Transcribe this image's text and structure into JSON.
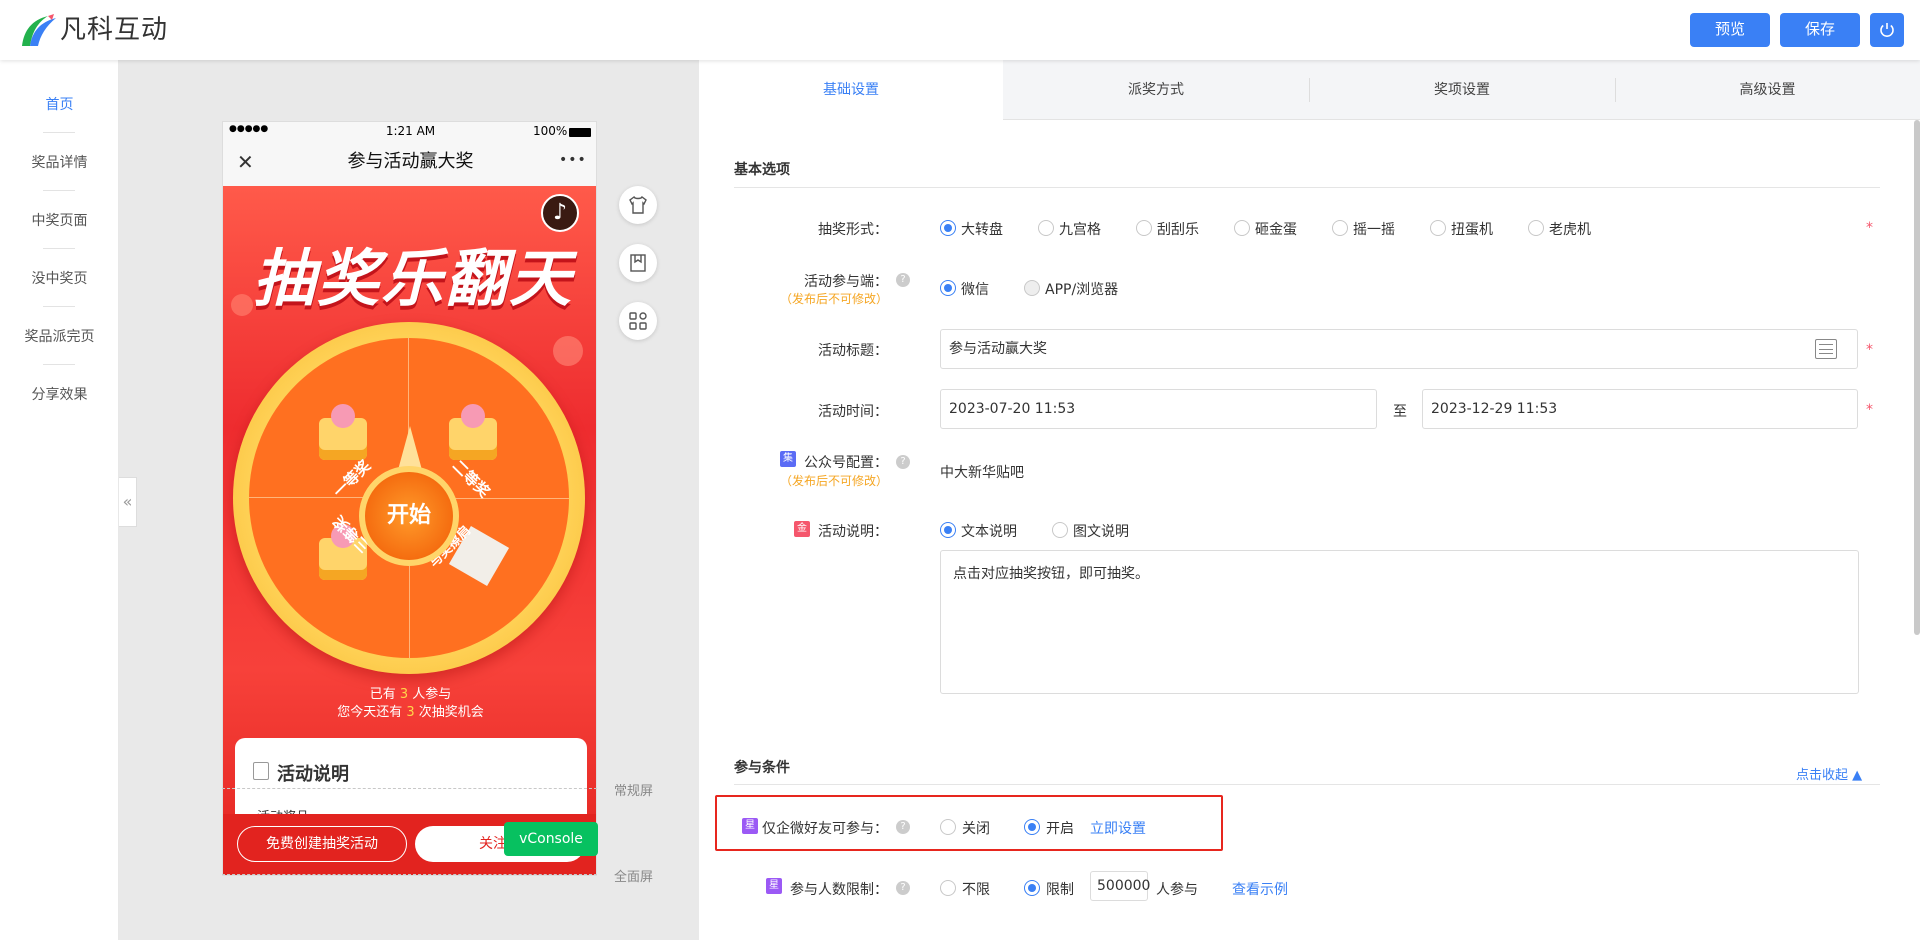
{
  "brand": {
    "name": "凡科互动",
    "colors": {
      "accent": "#3a80f5",
      "danger": "#e7261e",
      "vconsole": "#07c160"
    }
  },
  "header": {
    "preview_label": "预览",
    "save_label": "保存",
    "power_icon": "power-icon"
  },
  "sidebar": {
    "items": [
      {
        "label": "首页",
        "active": true
      },
      {
        "label": "奖品详情"
      },
      {
        "label": "中奖页面"
      },
      {
        "label": "没中奖页"
      },
      {
        "label": "奖品派完页"
      },
      {
        "label": "分享效果"
      }
    ]
  },
  "collapse_handle": "«",
  "phone": {
    "status": {
      "signal": "●●●●●",
      "time": "1:21 AM",
      "battery": "100%"
    },
    "nav": {
      "close": "✕",
      "title": "参与活动赢大奖",
      "more": "•••"
    },
    "banner_title": "抽奖乐翻天",
    "music_icon": "♪",
    "wheel": {
      "start_label": "开始",
      "prizes": [
        "一等奖",
        "二等奖",
        "三等奖",
        "与奖擦肩"
      ]
    },
    "join_line1_prefix": "已有",
    "join_count": "3",
    "join_line1_suffix": "人参与",
    "join_line2_prefix": "您今天还有",
    "chance_count": "3",
    "join_line2_suffix": "次抽奖机会",
    "rules": {
      "title": "活动说明",
      "prize_heading": "活动奖品"
    },
    "bottom": {
      "create_label": "免费创建抽奖活动",
      "follow_label": "关注我"
    }
  },
  "vconsole_label": "vConsole",
  "screen_markers": {
    "normal": "常规屏",
    "full": "全面屏"
  },
  "side_tools": [
    "shirt-icon",
    "page-icon",
    "grid-icon"
  ],
  "tabs": [
    {
      "label": "基础设置",
      "active": true
    },
    {
      "label": "派奖方式"
    },
    {
      "label": "奖项设置"
    },
    {
      "label": "高级设置"
    }
  ],
  "basic": {
    "section_title": "基本选项",
    "form_type": {
      "label": "抽奖形式：",
      "options": [
        "大转盘",
        "九宫格",
        "刮刮乐",
        "砸金蛋",
        "摇一摇",
        "扭蛋机",
        "老虎机"
      ],
      "selected": "大转盘"
    },
    "terminal": {
      "label": "活动参与端：",
      "note": "（发布后不可修改）",
      "options": [
        "微信",
        "APP/浏览器"
      ],
      "selected": "微信"
    },
    "title": {
      "label": "活动标题：",
      "value": "参与活动赢大奖"
    },
    "time": {
      "label": "活动时间：",
      "start": "2023-07-20 11:53",
      "to": "至",
      "end": "2023-12-29 11:53"
    },
    "official": {
      "tag": "集",
      "label": "公众号配置：",
      "note": "（发布后不可修改）",
      "value": "中大新华贴吧"
    },
    "desc": {
      "tag": "金",
      "label": "活动说明：",
      "options": [
        "文本说明",
        "图文说明"
      ],
      "selected": "文本说明",
      "text": "点击对应抽奖按钮，即可抽奖。"
    }
  },
  "conditions": {
    "section_title": "参与条件",
    "collapse_link": "点击收起 ▲",
    "wecom": {
      "tag": "星",
      "label": "仅企微好友可参与：",
      "options": [
        "关闭",
        "开启"
      ],
      "selected": "开启",
      "link": "立即设置"
    },
    "limit": {
      "tag": "星",
      "label": "参与人数限制：",
      "options": [
        "不限",
        "限制"
      ],
      "selected": "限制",
      "value": "500000",
      "suffix": "人参与",
      "link": "查看示例"
    }
  }
}
